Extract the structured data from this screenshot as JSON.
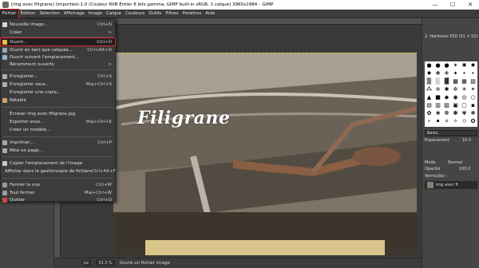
{
  "window": {
    "title": "[img avec filigrane] (importée)-1.0 (Couleur RVB Entier 8 bits gamma, GIMP built-in sRGB, 1 calque) 3960x1984 – GIMP",
    "minimize": "—",
    "maximize": "☐",
    "close": "✕"
  },
  "menubar": {
    "items": [
      "Fichier",
      "Édition",
      "Sélection",
      "Affichage",
      "Image",
      "Calque",
      "Couleurs",
      "Outils",
      "Filtres",
      "Fenêtres",
      "Aide"
    ]
  },
  "file_menu": {
    "items": [
      {
        "label": "Nouvelle image...",
        "shortcut": "Ctrl+N"
      },
      {
        "label": "Créer",
        "shortcut": ">"
      },
      {
        "label": "Ouvrir...",
        "shortcut": "Ctrl+O"
      },
      {
        "label": "Ouvrir en tant que calques...",
        "shortcut": "Ctrl+Alt+O"
      },
      {
        "label": "Ouvrir suivant l'emplacement...",
        "shortcut": ""
      },
      {
        "label": "Récemment ouverts",
        "shortcut": ">"
      },
      {
        "label": "Enregistrer...",
        "shortcut": "Ctrl+S"
      },
      {
        "label": "Enregistrer sous...",
        "shortcut": "Maj+Ctrl+S"
      },
      {
        "label": "Enregistrer une copie...",
        "shortcut": ""
      },
      {
        "label": "Rétablir",
        "shortcut": ""
      },
      {
        "label": "Écraser img avec filigrane.jpg",
        "shortcut": ""
      },
      {
        "label": "Exporter sous...",
        "shortcut": "Maj+Ctrl+E"
      },
      {
        "label": "Créer un modèle...",
        "shortcut": ""
      },
      {
        "label": "Imprimer...",
        "shortcut": "Ctrl+P"
      },
      {
        "label": "Mise en page...",
        "shortcut": ""
      },
      {
        "label": "Copier l'emplacement de l'image",
        "shortcut": ""
      },
      {
        "label": "Afficher dans le gestionnaire de fichiers",
        "shortcut": "Ctrl+Alt+F"
      },
      {
        "label": "Fermer la vue",
        "shortcut": "Ctrl+W"
      },
      {
        "label": "Tout fermer",
        "shortcut": "Maj+Ctrl+W"
      },
      {
        "label": "Quitter",
        "shortcut": "Ctrl+Q"
      }
    ]
  },
  "canvas": {
    "watermark": "Filigrane"
  },
  "statusbar": {
    "unit": "px",
    "zoom": "33.3 %",
    "message": "Ouvre un fichier image"
  },
  "dock": {
    "brush_name": "2. Hardness 050 (51 × 51)",
    "brush_preset": "Basic,",
    "spacing_label": "Espacement",
    "spacing_value": "10.0",
    "mode_label": "Mode",
    "mode_value": "Normal",
    "opacity_label": "Opacité",
    "opacity_value": "100.0",
    "lock_label": "Verrouiller :",
    "layer_name": "img avec fi"
  },
  "colors": {
    "highlight": "#e0242b",
    "menu_bg": "#3c3c3c",
    "panel_bg": "#454545"
  }
}
